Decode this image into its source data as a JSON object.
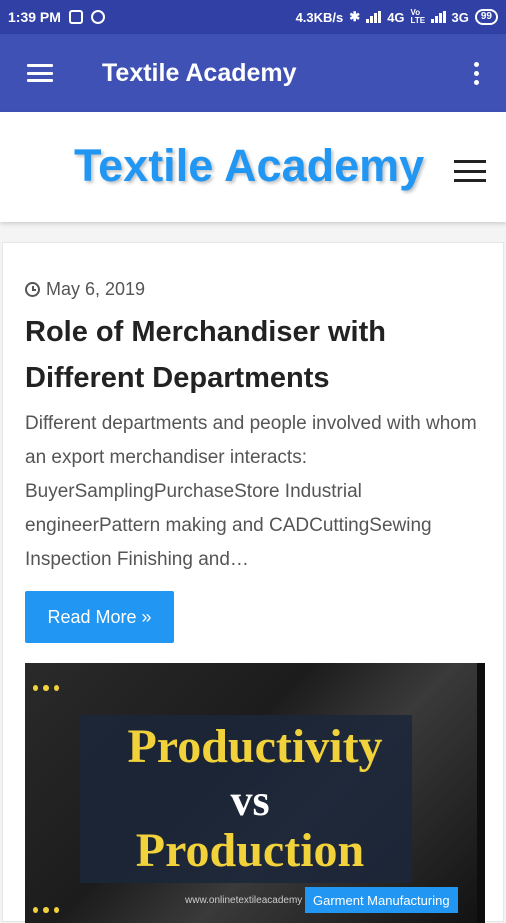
{
  "status_bar": {
    "time": "1:39 PM",
    "net_speed": "4.3KB/s",
    "network1": "4G",
    "volte": "Vo LTE",
    "network2": "3G",
    "battery": "99"
  },
  "app_bar": {
    "title": "Textile Academy"
  },
  "site_header": {
    "title": "Textile Academy"
  },
  "post": {
    "date": "May 6, 2019",
    "title": "Role of Merchandiser with Different Departments",
    "excerpt": "Different departments and people involved with whom an export merchandiser interacts: BuyerSamplingPurchaseStore Industrial engineerPattern making and CADCuttingSewing Inspection Finishing and…",
    "read_more": "Read More »",
    "thumbnail": {
      "line1": "Productivity",
      "line2": "vs",
      "line3": "Production",
      "url": "www.onlinetextileacademy",
      "badge": "Garment Manufacturing"
    }
  },
  "colors": {
    "status_bar": "#3140a5",
    "app_bar": "#3f51b5",
    "accent": "#2196f3"
  }
}
